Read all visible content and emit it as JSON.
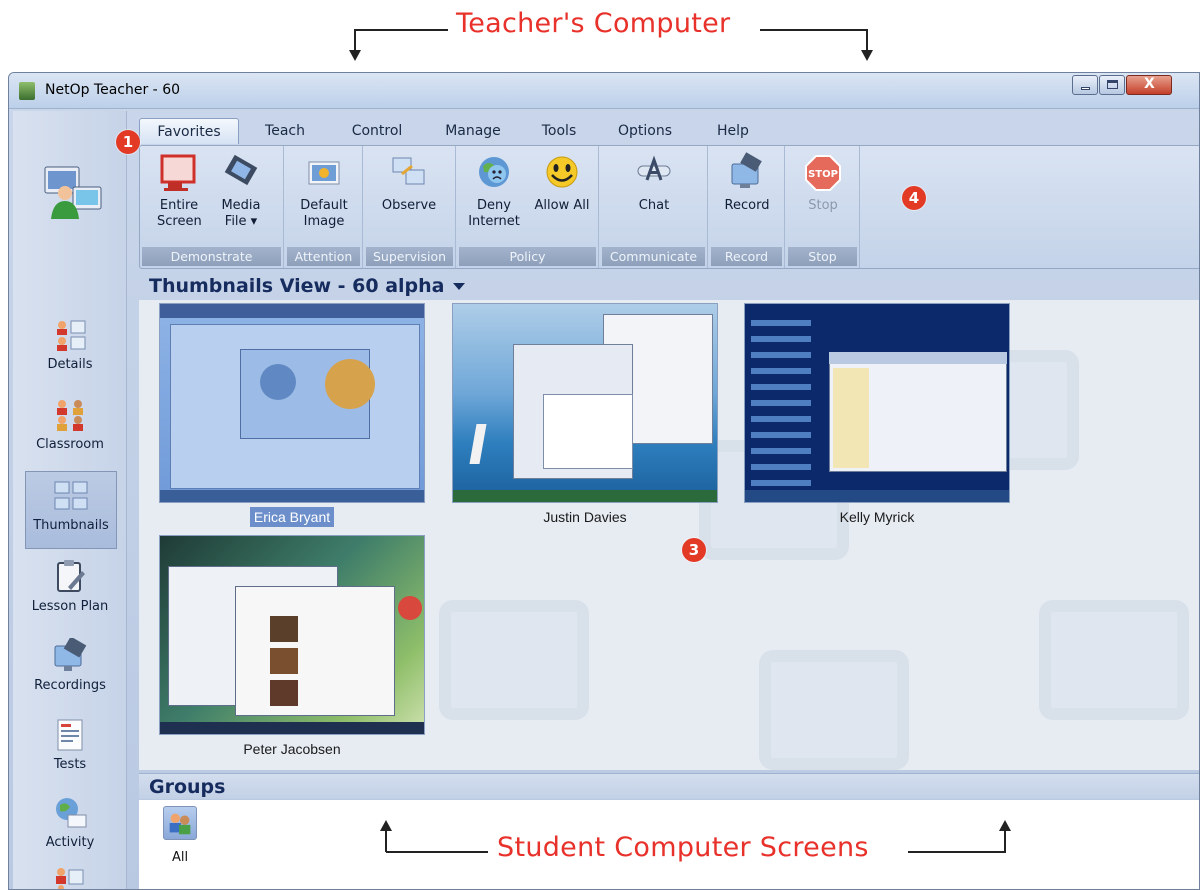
{
  "annotations": {
    "top_callout": "Teacher's Computer",
    "bottom_callout": "Student Computer Screens",
    "badges": [
      "1",
      "3",
      "4"
    ]
  },
  "window": {
    "title": "NetOp Teacher - 60",
    "icon": "netop-app-icon"
  },
  "tabs": [
    {
      "label": "Favorites",
      "active": true
    },
    {
      "label": "Teach"
    },
    {
      "label": "Control"
    },
    {
      "label": "Manage"
    },
    {
      "label": "Tools"
    },
    {
      "label": "Options"
    },
    {
      "label": "Help"
    }
  ],
  "ribbon": {
    "groups": [
      {
        "label": "Demonstrate",
        "buttons": [
          {
            "label": "Entire Screen",
            "icon": "monitor-icon"
          },
          {
            "label": "Media File ▾",
            "icon": "film-icon"
          }
        ]
      },
      {
        "label": "Attention",
        "buttons": [
          {
            "label": "Default Image",
            "icon": "image-icon"
          }
        ]
      },
      {
        "label": "Supervision",
        "buttons": [
          {
            "label": "Observe",
            "icon": "observe-icon"
          }
        ]
      },
      {
        "label": "Policy",
        "buttons": [
          {
            "label": "Deny Internet",
            "icon": "sad-globe-icon"
          },
          {
            "label": "Allow All",
            "icon": "smiley-icon"
          }
        ]
      },
      {
        "label": "Communicate",
        "buttons": [
          {
            "label": "Chat",
            "icon": "chat-icon"
          }
        ]
      },
      {
        "label": "Record",
        "buttons": [
          {
            "label": "Record",
            "icon": "record-icon"
          }
        ]
      },
      {
        "label": "Stop",
        "buttons": [
          {
            "label": "Stop",
            "icon": "stop-sign-icon",
            "disabled": true
          }
        ]
      }
    ]
  },
  "sidebar": {
    "items": [
      {
        "label": "Details",
        "icon": "details-icon"
      },
      {
        "label": "Classroom",
        "icon": "classroom-icon"
      },
      {
        "label": "Thumbnails",
        "icon": "thumbnails-icon",
        "selected": true
      },
      {
        "label": "Lesson Plan",
        "icon": "lesson-plan-icon"
      },
      {
        "label": "Recordings",
        "icon": "recordings-icon"
      },
      {
        "label": "Tests",
        "icon": "tests-icon"
      },
      {
        "label": "Activity",
        "icon": "activity-icon"
      }
    ]
  },
  "thumbnails": {
    "title": "Thumbnails View - 60 alpha",
    "students": [
      {
        "name": "Erica Bryant",
        "selected": true
      },
      {
        "name": "Justin Davies"
      },
      {
        "name": "Kelly Myrick"
      },
      {
        "name": "Peter Jacobsen"
      }
    ]
  },
  "groups": {
    "title": "Groups",
    "items": [
      {
        "label": "All",
        "icon": "group-all-icon"
      }
    ]
  },
  "colors": {
    "accent_red": "#e8312a",
    "header_blue": "#172c5e",
    "ribbon_bg": "#c4d3e9"
  }
}
